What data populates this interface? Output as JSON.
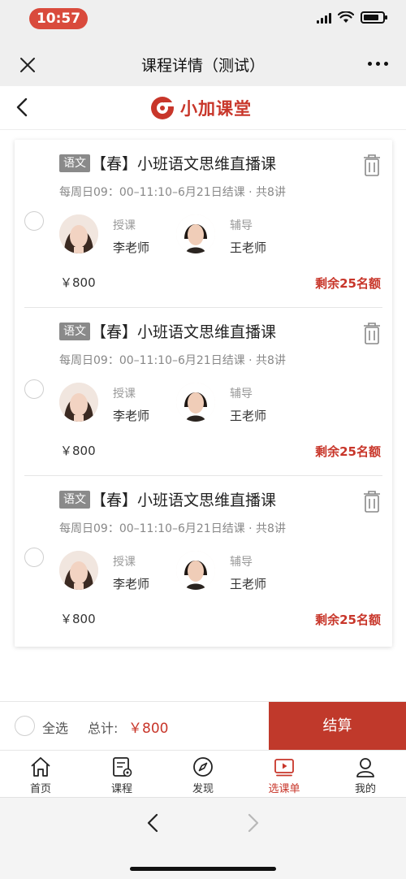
{
  "status": {
    "time": "10:57"
  },
  "wechat": {
    "title": "课程详情（测试）"
  },
  "app": {
    "logo_text": "小加课堂"
  },
  "courses": [
    {
      "tag": "语文",
      "title": "【春】小班语文思维直播课",
      "schedule": "每周日09：00–11:10–6月21日结课 · 共8讲",
      "teacher_role": "授课",
      "teacher_name": "李老师",
      "tutor_role": "辅导",
      "tutor_name": "王老师",
      "price": "￥800",
      "remaining": "剩余25名额"
    },
    {
      "tag": "语文",
      "title": "【春】小班语文思维直播课",
      "schedule": "每周日09：00–11:10–6月21日结课 · 共8讲",
      "teacher_role": "授课",
      "teacher_name": "李老师",
      "tutor_role": "辅导",
      "tutor_name": "王老师",
      "price": "￥800",
      "remaining": "剩余25名额"
    },
    {
      "tag": "语文",
      "title": "【春】小班语文思维直播课",
      "schedule": "每周日09：00–11:10–6月21日结课 · 共8讲",
      "teacher_role": "授课",
      "teacher_name": "李老师",
      "tutor_role": "辅导",
      "tutor_name": "王老师",
      "price": "￥800",
      "remaining": "剩余25名额"
    }
  ],
  "checkout": {
    "select_all": "全选",
    "total_label": "总计:",
    "total_value": "￥800",
    "button": "结算"
  },
  "tabs": [
    {
      "label": "首页",
      "icon": "home-icon"
    },
    {
      "label": "课程",
      "icon": "course-icon"
    },
    {
      "label": "发现",
      "icon": "compass-icon"
    },
    {
      "label": "选课单",
      "icon": "video-list-icon",
      "active": true
    },
    {
      "label": "我的",
      "icon": "person-icon"
    }
  ],
  "colors": {
    "brand": "#c8362a",
    "checkout_bg": "#c0392b",
    "status_pill": "#d94a3c"
  }
}
